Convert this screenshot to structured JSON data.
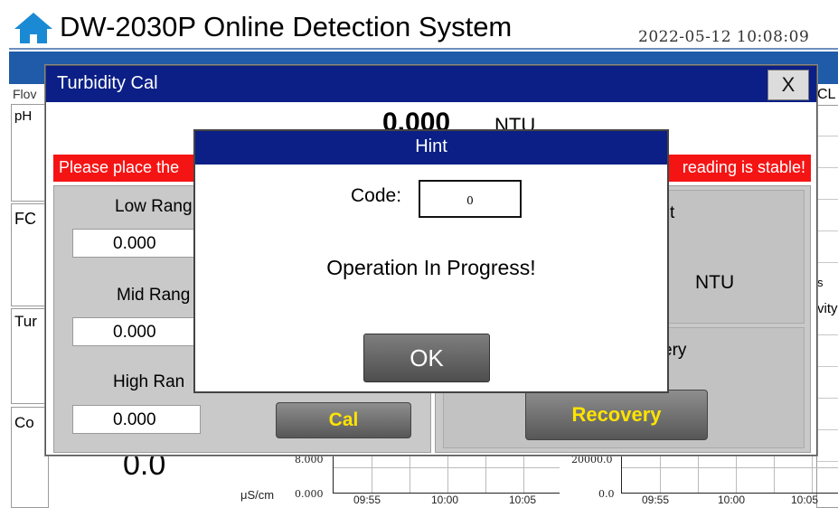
{
  "header": {
    "title": "DW-2030P Online Detection System",
    "datetime": "2022-05-12  10:08:09"
  },
  "background": {
    "left_labels": [
      "Flov",
      "pH",
      "FC",
      "Tur",
      "Co"
    ],
    "right_labels": [
      "CL",
      "s",
      "vity"
    ],
    "conductivity_value": "0.0",
    "unit": "μS/cm",
    "chart_left": {
      "y_top": "8.000",
      "y_bottom": "0.000",
      "x_ticks": [
        "09:55",
        "10:00",
        "10:05"
      ]
    },
    "chart_right": {
      "y_top": "20000.0",
      "y_bottom": "0.0",
      "x_ticks": [
        "09:55",
        "10:00",
        "10:05"
      ]
    }
  },
  "cal_dialog": {
    "title": "Turbidity Cal",
    "close_label": "X",
    "reading_value": "0.000",
    "reading_unit": "NTU",
    "banner_left": "Please place the",
    "banner_right": "reading is stable!",
    "low_label": "Low Rang",
    "low_value": "0.000",
    "mid_label": "Mid Rang",
    "mid_value": "0.000",
    "high_label": "High Ran",
    "high_value": "0.000",
    "cal_button": "Cal",
    "right_partial_label": "t",
    "right_unit": "NTU",
    "recovery_partial_label": "ery",
    "recovery_button": "Recovery"
  },
  "hint_dialog": {
    "title": "Hint",
    "code_label": "Code:",
    "code_value": "0",
    "message": "Operation In Progress!",
    "ok_label": "OK"
  },
  "colors": {
    "title_bar": "#0b1f86",
    "banner": "#f51414",
    "button_text": "#ffe400",
    "header_band": "#1f5ba8"
  }
}
